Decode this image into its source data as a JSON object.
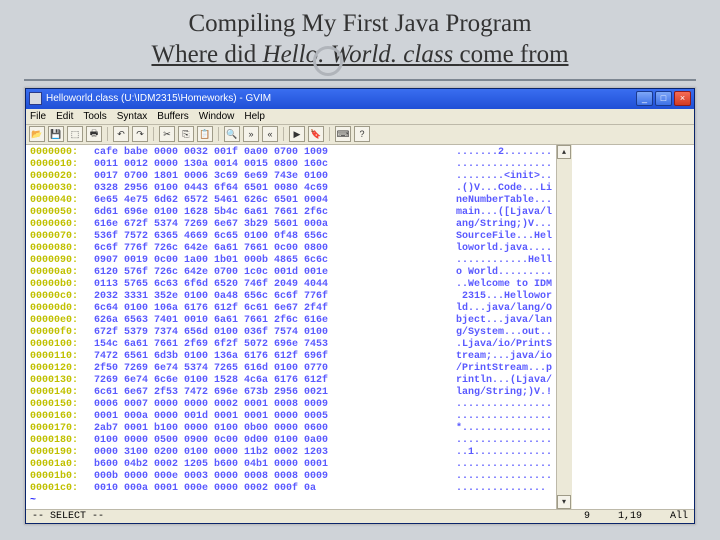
{
  "slide": {
    "title_line1": "Compiling My First Java Program",
    "title_line2_prefix": "Where did ",
    "title_line2_emph": "Hello. World. class ",
    "title_line2_suffix": "come from"
  },
  "window": {
    "title": "Helloworld.class (U:\\IDM2315\\Homeworks) - GVIM",
    "menu": [
      "File",
      "Edit",
      "Tools",
      "Syntax",
      "Buffers",
      "Window",
      "Help"
    ],
    "toolbar": [
      "open",
      "save",
      "saveall",
      "print",
      "|",
      "undo",
      "redo",
      "|",
      "cut",
      "copy",
      "paste",
      "|",
      "replace",
      "findnext",
      "findprev",
      "|",
      "make",
      "ctags",
      "|",
      "taglist",
      "help"
    ],
    "status_mode": "-- SELECT --",
    "status_col": "9",
    "status_pos": "1,19",
    "status_pct": "All",
    "caption_buttons": {
      "minimize": "_",
      "maximize": "□",
      "close": "×"
    }
  },
  "hex": [
    {
      "addr": "0000000:",
      "bytes": "cafe babe 0000 0032 001f 0a00 0700 1009",
      "asc": ".......2........"
    },
    {
      "addr": "0000010:",
      "bytes": "0011 0012 0000 130a 0014 0015 0800 160c",
      "asc": "................"
    },
    {
      "addr": "0000020:",
      "bytes": "0017 0700 1801 0006 3c69 6e69 743e 0100",
      "asc": "........<init>.."
    },
    {
      "addr": "0000030:",
      "bytes": "0328 2956 0100 0443 6f64 6501 0080 4c69",
      "asc": ".()V...Code...Li"
    },
    {
      "addr": "0000040:",
      "bytes": "6e65 4e75 6d62 6572 5461 626c 6501 0004",
      "asc": "neNumberTable..."
    },
    {
      "addr": "0000050:",
      "bytes": "6d61 696e 0100 1628 5b4c 6a61 7661 2f6c",
      "asc": "main...([Ljava/l"
    },
    {
      "addr": "0000060:",
      "bytes": "616e 672f 5374 7269 6e67 3b29 5601 000a",
      "asc": "ang/String;)V..."
    },
    {
      "addr": "0000070:",
      "bytes": "536f 7572 6365 4669 6c65 0100 0f48 656c",
      "asc": "SourceFile...Hel"
    },
    {
      "addr": "0000080:",
      "bytes": "6c6f 776f 726c 642e 6a61 7661 0c00 0800",
      "asc": "loworld.java...."
    },
    {
      "addr": "0000090:",
      "bytes": "0907 0019 0c00 1a00 1b01 000b 4865 6c6c",
      "asc": "............Hell"
    },
    {
      "addr": "00000a0:",
      "bytes": "6120 576f 726c 642e 0700 1c0c 001d 001e",
      "asc": "o World........."
    },
    {
      "addr": "00000b0:",
      "bytes": "0113 5765 6c63 6f6d 6520 746f 2049 4044",
      "asc": "..Welcome to IDM"
    },
    {
      "addr": "00000c0:",
      "bytes": "2032 3331 352e 0100 0a48 656c 6c6f 776f",
      "asc": " 2315...Hellowor"
    },
    {
      "addr": "00000d0:",
      "bytes": "6c64 0100 106a 6176 612f 6c61 6e67 2f4f",
      "asc": "ld...java/lang/O"
    },
    {
      "addr": "00000e0:",
      "bytes": "626a 6563 7401 0010 6a61 7661 2f6c 616e",
      "asc": "bject...java/lan"
    },
    {
      "addr": "00000f0:",
      "bytes": "672f 5379 7374 656d 0100 036f 7574 0100",
      "asc": "g/System...out.."
    },
    {
      "addr": "0000100:",
      "bytes": "154c 6a61 7661 2f69 6f2f 5072 696e 7453",
      "asc": ".Ljava/io/PrintS"
    },
    {
      "addr": "0000110:",
      "bytes": "7472 6561 6d3b 0100 136a 6176 612f 696f",
      "asc": "tream;...java/io"
    },
    {
      "addr": "0000120:",
      "bytes": "2f50 7269 6e74 5374 7265 616d 0100 0770",
      "asc": "/PrintStream...p"
    },
    {
      "addr": "0000130:",
      "bytes": "7269 6e74 6c6e 0100 1528 4c6a 6176 612f",
      "asc": "rintln...(Ljava/"
    },
    {
      "addr": "0000140:",
      "bytes": "6c61 6e67 2f53 7472 696e 673b 2956 0021",
      "asc": "lang/String;)V.!"
    },
    {
      "addr": "0000150:",
      "bytes": "0006 0007 0000 0000 0002 0001 0008 0009",
      "asc": "................"
    },
    {
      "addr": "0000160:",
      "bytes": "0001 000a 0000 001d 0001 0001 0000 0005",
      "asc": "................"
    },
    {
      "addr": "0000170:",
      "bytes": "2ab7 0001 b100 0000 0100 0b00 0000 0600",
      "asc": "*..............."
    },
    {
      "addr": "0000180:",
      "bytes": "0100 0000 0500 0900 0c00 0d00 0100 0a00",
      "asc": "................"
    },
    {
      "addr": "0000190:",
      "bytes": "0000 3100 0200 0100 0000 11b2 0002 1203",
      "asc": "..1............."
    },
    {
      "addr": "00001a0:",
      "bytes": "b600 04b2 0002 1205 b600 04b1 0000 0001",
      "asc": "................"
    },
    {
      "addr": "00001b0:",
      "bytes": "000b 0000 000e 0003 0000 0008 0008 0009",
      "asc": "................"
    },
    {
      "addr": "00001c0:",
      "bytes": "0010 000a 0001 000e 0000 0002 000f 0a  ",
      "asc": "..............."
    }
  ]
}
